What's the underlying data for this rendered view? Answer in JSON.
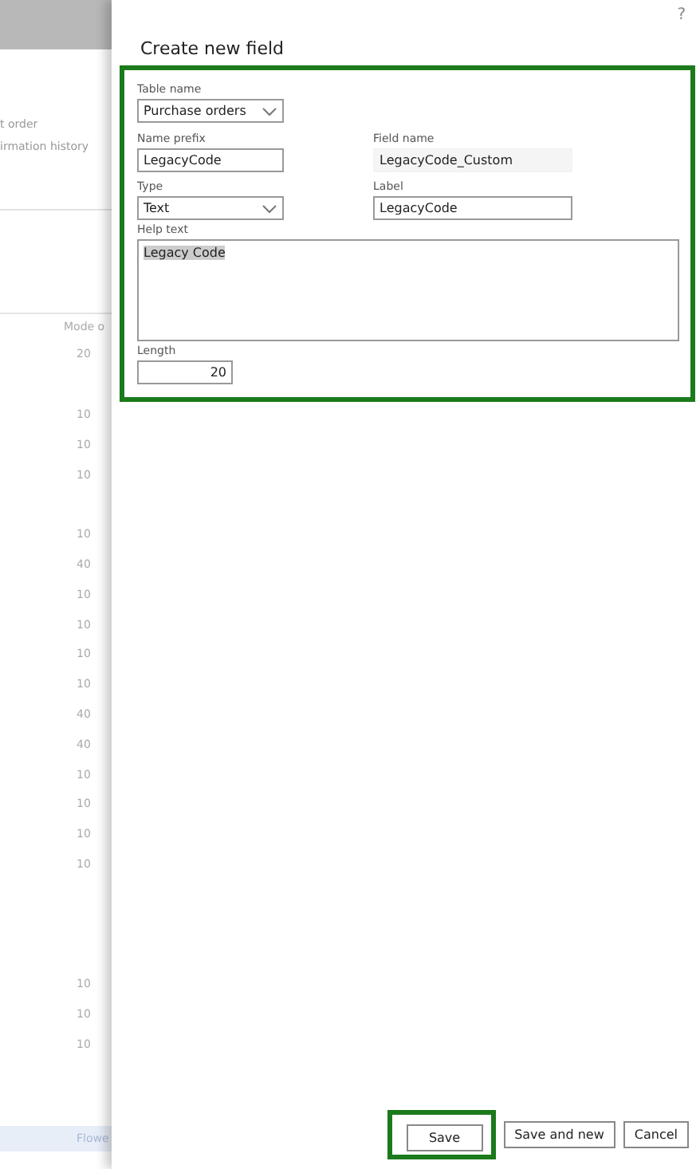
{
  "background": {
    "links": [
      "t order",
      "irmation history"
    ],
    "column_header": "Mode o",
    "rows": [
      {
        "value": "20"
      },
      {},
      {
        "value": "10"
      },
      {
        "value": "10"
      },
      {
        "value": "10"
      },
      {},
      {
        "value": "10"
      },
      {
        "value": "40"
      },
      {
        "value": "10"
      },
      {
        "value": "10"
      },
      {
        "value": "10"
      },
      {
        "value": "10"
      },
      {
        "value": "40"
      },
      {
        "value": "40"
      },
      {
        "value": "10"
      },
      {
        "value": "10"
      },
      {
        "value": "10"
      },
      {
        "value": "10"
      },
      {},
      {},
      {},
      {
        "value": "10"
      },
      {
        "value": "10"
      },
      {
        "value": "10"
      }
    ],
    "footer": "Flowe"
  },
  "dialog": {
    "help": "?",
    "title": "Create new field",
    "table_name": {
      "label": "Table name",
      "value": "Purchase orders"
    },
    "name_prefix": {
      "label": "Name prefix",
      "value": "LegacyCode"
    },
    "field_name": {
      "label": "Field name",
      "value": "LegacyCode_Custom"
    },
    "type": {
      "label": "Type",
      "value": "Text"
    },
    "label": {
      "label": "Label",
      "value": "LegacyCode"
    },
    "help_text": {
      "label": "Help text",
      "value": "Legacy Code"
    },
    "length": {
      "label": "Length",
      "value": "20"
    },
    "buttons": [
      {
        "label": "Save",
        "highlighted": true
      },
      {
        "label": "Save and new",
        "highlighted": false
      },
      {
        "label": "Cancel",
        "highlighted": false
      }
    ]
  }
}
